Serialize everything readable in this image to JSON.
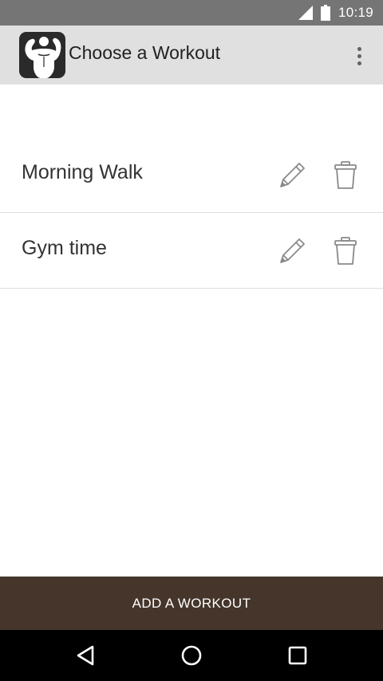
{
  "status_bar": {
    "time": "10:19",
    "icons": [
      "cell-signal-icon",
      "battery-icon"
    ]
  },
  "app_bar": {
    "title": "Choose a Workout",
    "logo_icon": "bodybuilder-logo-icon",
    "menu_icon": "overflow-menu-icon",
    "background": "#e0e0e0"
  },
  "workouts": [
    {
      "name": "Morning Walk",
      "edit_icon": "pencil-icon",
      "delete_icon": "trash-icon"
    },
    {
      "name": "Gym time",
      "edit_icon": "pencil-icon",
      "delete_icon": "trash-icon"
    }
  ],
  "actions": {
    "add_label": "ADD A WORKOUT",
    "add_color": "#45352a"
  },
  "nav_bar": {
    "icons": [
      "back-icon",
      "home-icon",
      "recents-icon"
    ]
  }
}
